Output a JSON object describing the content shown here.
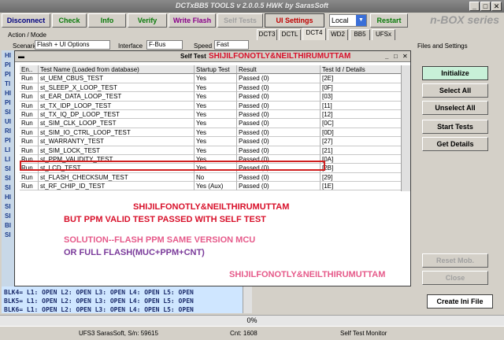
{
  "window": {
    "title": "DCTxBB5 TOOLS v 2.0.0.5 HWK by SarasSoft",
    "min": "_",
    "max": "□",
    "close": "✕"
  },
  "toolbar": {
    "disconnect": "Disconnect",
    "check": "Check",
    "info": "Info",
    "verify": "Verify",
    "write_flash": "Write Flash",
    "self_tests": "Self Tests",
    "ui_settings": "UI Settings",
    "mode_select": "Local",
    "restart": "Restart",
    "brand": "n-BOX series"
  },
  "action_mode": {
    "header": "Action / Mode",
    "scenario_label": "Scenario",
    "scenario_value": "Flash + UI Options",
    "interface_label": "Interface",
    "interface_value": "F-Bus",
    "speed_label": "Speed",
    "speed_value": "Fast"
  },
  "tabs": [
    "DCT3",
    "DCTL",
    "DCT4",
    "WD2",
    "BB5",
    "UFSx"
  ],
  "files_settings": "Files and Settings",
  "left_channels": [
    "HI",
    "PI",
    "PI",
    "TI",
    "HI",
    "PI",
    "SI",
    "UI",
    "RI",
    "PI",
    "LI",
    "LI",
    "SI",
    "SI",
    "SI",
    "HI",
    "SI",
    "SI",
    "BI",
    "SI"
  ],
  "log_lines": [
    "BLK4= L1: OPEN L2: OPEN L3: OPEN L4: OPEN L5: OPEN",
    "BLK5= L1: OPEN L2: OPEN L3: OPEN L4: OPEN L5: OPEN",
    "BLK6= L1: OPEN L2: OPEN L3: OPEN L4: OPEN L5: OPEN"
  ],
  "dialog": {
    "title": "Self Test",
    "watermark": "SHIJILFONOTLY&NEILTHIRUMUTTAM",
    "columns": [
      "En..",
      "Test Name (Loaded from database)",
      "Startup Test",
      "Result",
      "Test Id / Details"
    ],
    "rows": [
      [
        "Run",
        "st_UEM_CBUS_TEST",
        "Yes",
        "Passed (0)",
        "[2E]"
      ],
      [
        "Run",
        "st_SLEEP_X_LOOP_TEST",
        "Yes",
        "Passed (0)",
        "[0F]"
      ],
      [
        "Run",
        "st_EAR_DATA_LOOP_TEST",
        "Yes",
        "Passed (0)",
        "[03]"
      ],
      [
        "Run",
        "st_TX_IDP_LOOP_TEST",
        "Yes",
        "Passed (0)",
        "[11]"
      ],
      [
        "Run",
        "st_TX_IQ_DP_LOOP_TEST",
        "Yes",
        "Passed (0)",
        "[12]"
      ],
      [
        "Run",
        "st_SIM_CLK_LOOP_TEST",
        "Yes",
        "Passed (0)",
        "[0C]"
      ],
      [
        "Run",
        "st_SIM_IO_CTRL_LOOP_TEST",
        "Yes",
        "Passed (0)",
        "[0D]"
      ],
      [
        "Run",
        "st_WARRANTY_TEST",
        "Yes",
        "Passed (0)",
        "[27]"
      ],
      [
        "Run",
        "st_SIM_LOCK_TEST",
        "Yes",
        "Passed (0)",
        "[21]"
      ],
      [
        "Run",
        "st_PPM_VALIDITY_TEST",
        "Yes",
        "Passed (0)",
        "[0A]"
      ],
      [
        "Run",
        "st_LCD_TEST",
        "Yes",
        "Passed (0)",
        "[2B]"
      ],
      [
        "Run",
        "st_FLASH_CHECKSUM_TEST",
        "No",
        "Passed (0)",
        "[29]"
      ],
      [
        "Run",
        "st_RF_CHIP_ID_TEST",
        "Yes (Aux)",
        "Passed (0)",
        "[1E]"
      ]
    ],
    "note1": "SHIJILFONOTLY&NEILTHIRUMUTTAM",
    "note2": "BUT PPM VALID TEST PASSED WITH SELF TEST",
    "note3": "SOLUTION--FLASH PPM SAME VERSION MCU",
    "note4": "OR FULL FLASH(MUC+PPM+CNT)",
    "note5": "SHIJILFONOTLY&NEILTHIRUMUTTAM"
  },
  "right_buttons": {
    "initialize": "Initialize",
    "select_all": "Select All",
    "unselect_all": "Unselect All",
    "start_tests": "Start Tests",
    "get_details": "Get Details",
    "reset_mob": "Reset Mob.",
    "close": "Close",
    "create_ini": "Create Ini File"
  },
  "progress": "0%",
  "status": {
    "serial": "UFS3 SarasSoft, S/n: 59615",
    "cnt": "Cnt: 1608",
    "monitor": "Self Test Monitor"
  }
}
